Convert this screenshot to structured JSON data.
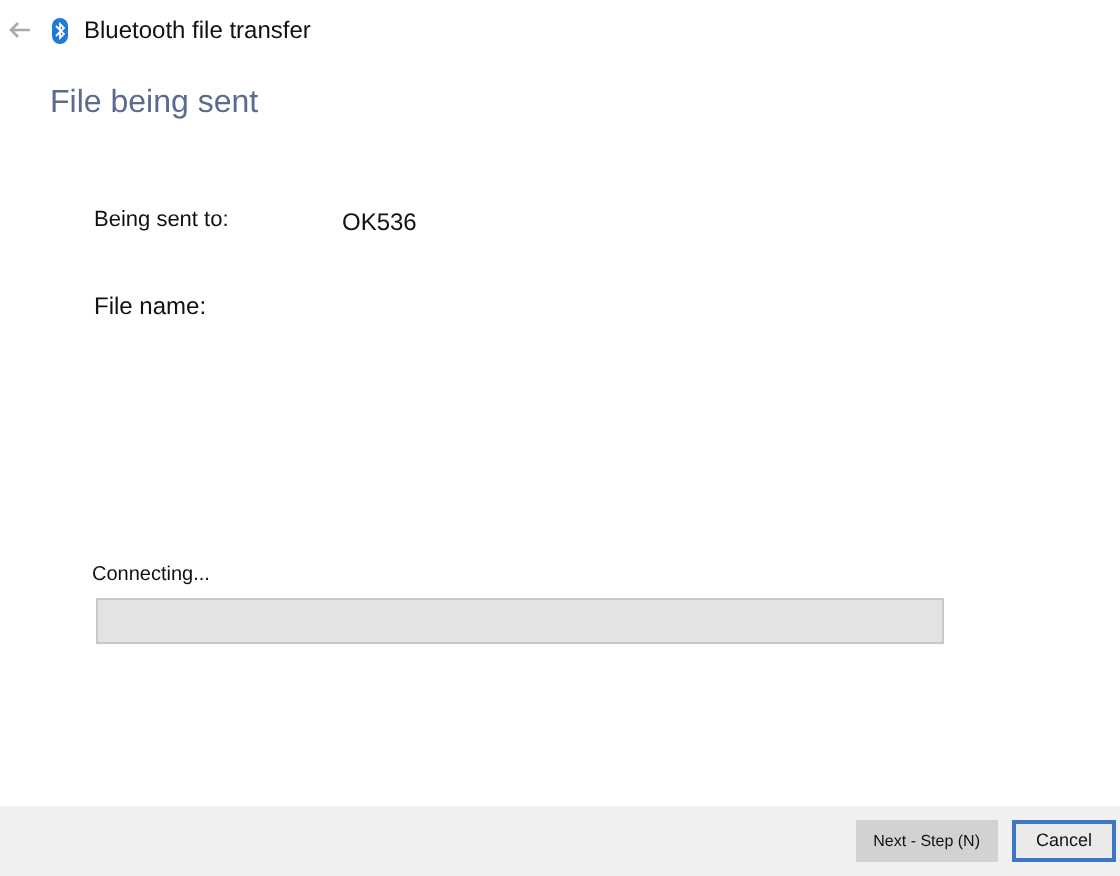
{
  "window": {
    "title": "Bluetooth file transfer"
  },
  "heading": "File being sent",
  "fields": [
    {
      "label": "Being sent to:",
      "value": "OK536"
    },
    {
      "label": "File name:"
    }
  ],
  "progress": {
    "label": "Connecting...",
    "level": 0
  },
  "buttons": [
    {
      "label": "Next - Step (N)",
      "disabled": true
    },
    {
      "label": "Cancel",
      "disabled": false
    }
  ]
}
